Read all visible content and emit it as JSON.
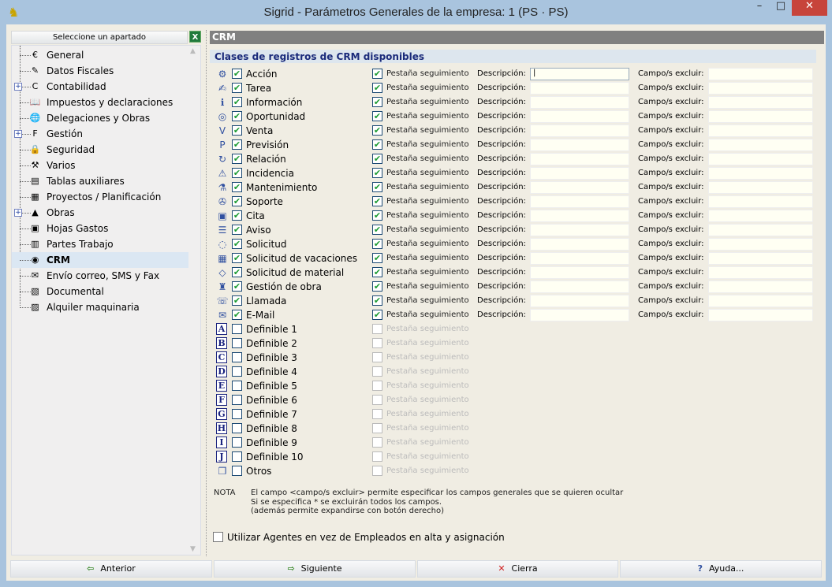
{
  "window": {
    "title": "Sigrid - Parámetros Generales de la empresa: 1 (PS · PS)",
    "minimize": "–",
    "maximize": "□",
    "close": "✕"
  },
  "sidebar": {
    "header": "Seleccione un apartado",
    "items": [
      {
        "label": "General",
        "icon": "€",
        "expand": false
      },
      {
        "label": "Datos Fiscales",
        "icon": "✎",
        "expand": false
      },
      {
        "label": "Contabilidad",
        "icon": "C",
        "expand": true
      },
      {
        "label": "Impuestos y declaraciones",
        "icon": "📖",
        "expand": false
      },
      {
        "label": "Delegaciones y Obras",
        "icon": "🌐",
        "expand": false
      },
      {
        "label": "Gestión",
        "icon": "F",
        "expand": true
      },
      {
        "label": "Seguridad",
        "icon": "🔒",
        "expand": false
      },
      {
        "label": "Varios",
        "icon": "⚒",
        "expand": false
      },
      {
        "label": "Tablas auxiliares",
        "icon": "▤",
        "expand": false
      },
      {
        "label": "Proyectos / Planificación",
        "icon": "▦",
        "expand": false
      },
      {
        "label": "Obras",
        "icon": "▲",
        "expand": true
      },
      {
        "label": "Hojas Gastos",
        "icon": "▣",
        "expand": false
      },
      {
        "label": "Partes Trabajo",
        "icon": "▥",
        "expand": false
      },
      {
        "label": "CRM",
        "icon": "◉",
        "expand": false,
        "selected": true
      },
      {
        "label": "Envío correo, SMS y Fax",
        "icon": "✉",
        "expand": false
      },
      {
        "label": "Documental",
        "icon": "▧",
        "expand": false
      },
      {
        "label": "Alquiler maquinaria",
        "icon": "▨",
        "expand": false
      }
    ]
  },
  "main": {
    "header": "CRM",
    "section": "Clases de registros de CRM disponibles",
    "pestana_label": "Pestaña seguimiento",
    "descripcion_label": "Descripción:",
    "campo_label": "Campo/s excluir:",
    "check_glyph": "✔",
    "rows": [
      {
        "label": "Acción",
        "icon": "⚙",
        "enabled": true
      },
      {
        "label": "Tarea",
        "icon": "✍",
        "enabled": true
      },
      {
        "label": "Información",
        "icon": "ℹ",
        "enabled": true
      },
      {
        "label": "Oportunidad",
        "icon": "◎",
        "enabled": true
      },
      {
        "label": "Venta",
        "icon": "V",
        "enabled": true
      },
      {
        "label": "Previsión",
        "icon": "P",
        "enabled": true
      },
      {
        "label": "Relación",
        "icon": "↻",
        "enabled": true
      },
      {
        "label": "Incidencia",
        "icon": "⚠",
        "enabled": true
      },
      {
        "label": "Mantenimiento",
        "icon": "⚗",
        "enabled": true
      },
      {
        "label": "Soporte",
        "icon": "✇",
        "enabled": true
      },
      {
        "label": "Cita",
        "icon": "▣",
        "enabled": true
      },
      {
        "label": "Aviso",
        "icon": "☰",
        "enabled": true
      },
      {
        "label": "Solicitud",
        "icon": "◌",
        "enabled": true
      },
      {
        "label": "Solicitud de vacaciones",
        "icon": "▦",
        "enabled": true
      },
      {
        "label": "Solicitud de material",
        "icon": "◇",
        "enabled": true
      },
      {
        "label": "Gestión de obra",
        "icon": "♜",
        "enabled": true
      },
      {
        "label": "Llamada",
        "icon": "☏",
        "enabled": true
      },
      {
        "label": "E-Mail",
        "icon": "✉",
        "enabled": true
      },
      {
        "label": "Definible 1",
        "icon": "A",
        "enabled": false,
        "def": true
      },
      {
        "label": "Definible 2",
        "icon": "B",
        "enabled": false,
        "def": true
      },
      {
        "label": "Definible 3",
        "icon": "C",
        "enabled": false,
        "def": true
      },
      {
        "label": "Definible 4",
        "icon": "D",
        "enabled": false,
        "def": true
      },
      {
        "label": "Definible 5",
        "icon": "E",
        "enabled": false,
        "def": true
      },
      {
        "label": "Definible 6",
        "icon": "F",
        "enabled": false,
        "def": true
      },
      {
        "label": "Definible 7",
        "icon": "G",
        "enabled": false,
        "def": true
      },
      {
        "label": "Definible 8",
        "icon": "H",
        "enabled": false,
        "def": true
      },
      {
        "label": "Definible 9",
        "icon": "I",
        "enabled": false,
        "def": true
      },
      {
        "label": "Definible 10",
        "icon": "J",
        "enabled": false,
        "def": true
      },
      {
        "label": "Otros",
        "icon": "❐",
        "enabled": false
      }
    ],
    "nota_label": "NOTA",
    "nota_lines": [
      "El campo <campo/s excluir> permite especificar los campos generales que se quieren ocultar",
      "Si se especifica * se excluirán todos los campos.",
      "(además permite expandirse con botón derecho)"
    ],
    "agentes_label": "Utilizar Agentes en vez de Empleados en alta y asignación",
    "agentes_checked": false
  },
  "buttons": [
    {
      "label": "Anterior",
      "icon": "⇦",
      "color": "#3a8a2a"
    },
    {
      "label": "Siguiente",
      "icon": "⇨",
      "color": "#3a8a2a"
    },
    {
      "label": "Cierra",
      "icon": "✕",
      "color": "#d02020"
    },
    {
      "label": "Ayuda...",
      "icon": "?",
      "color": "#3050a0"
    }
  ]
}
